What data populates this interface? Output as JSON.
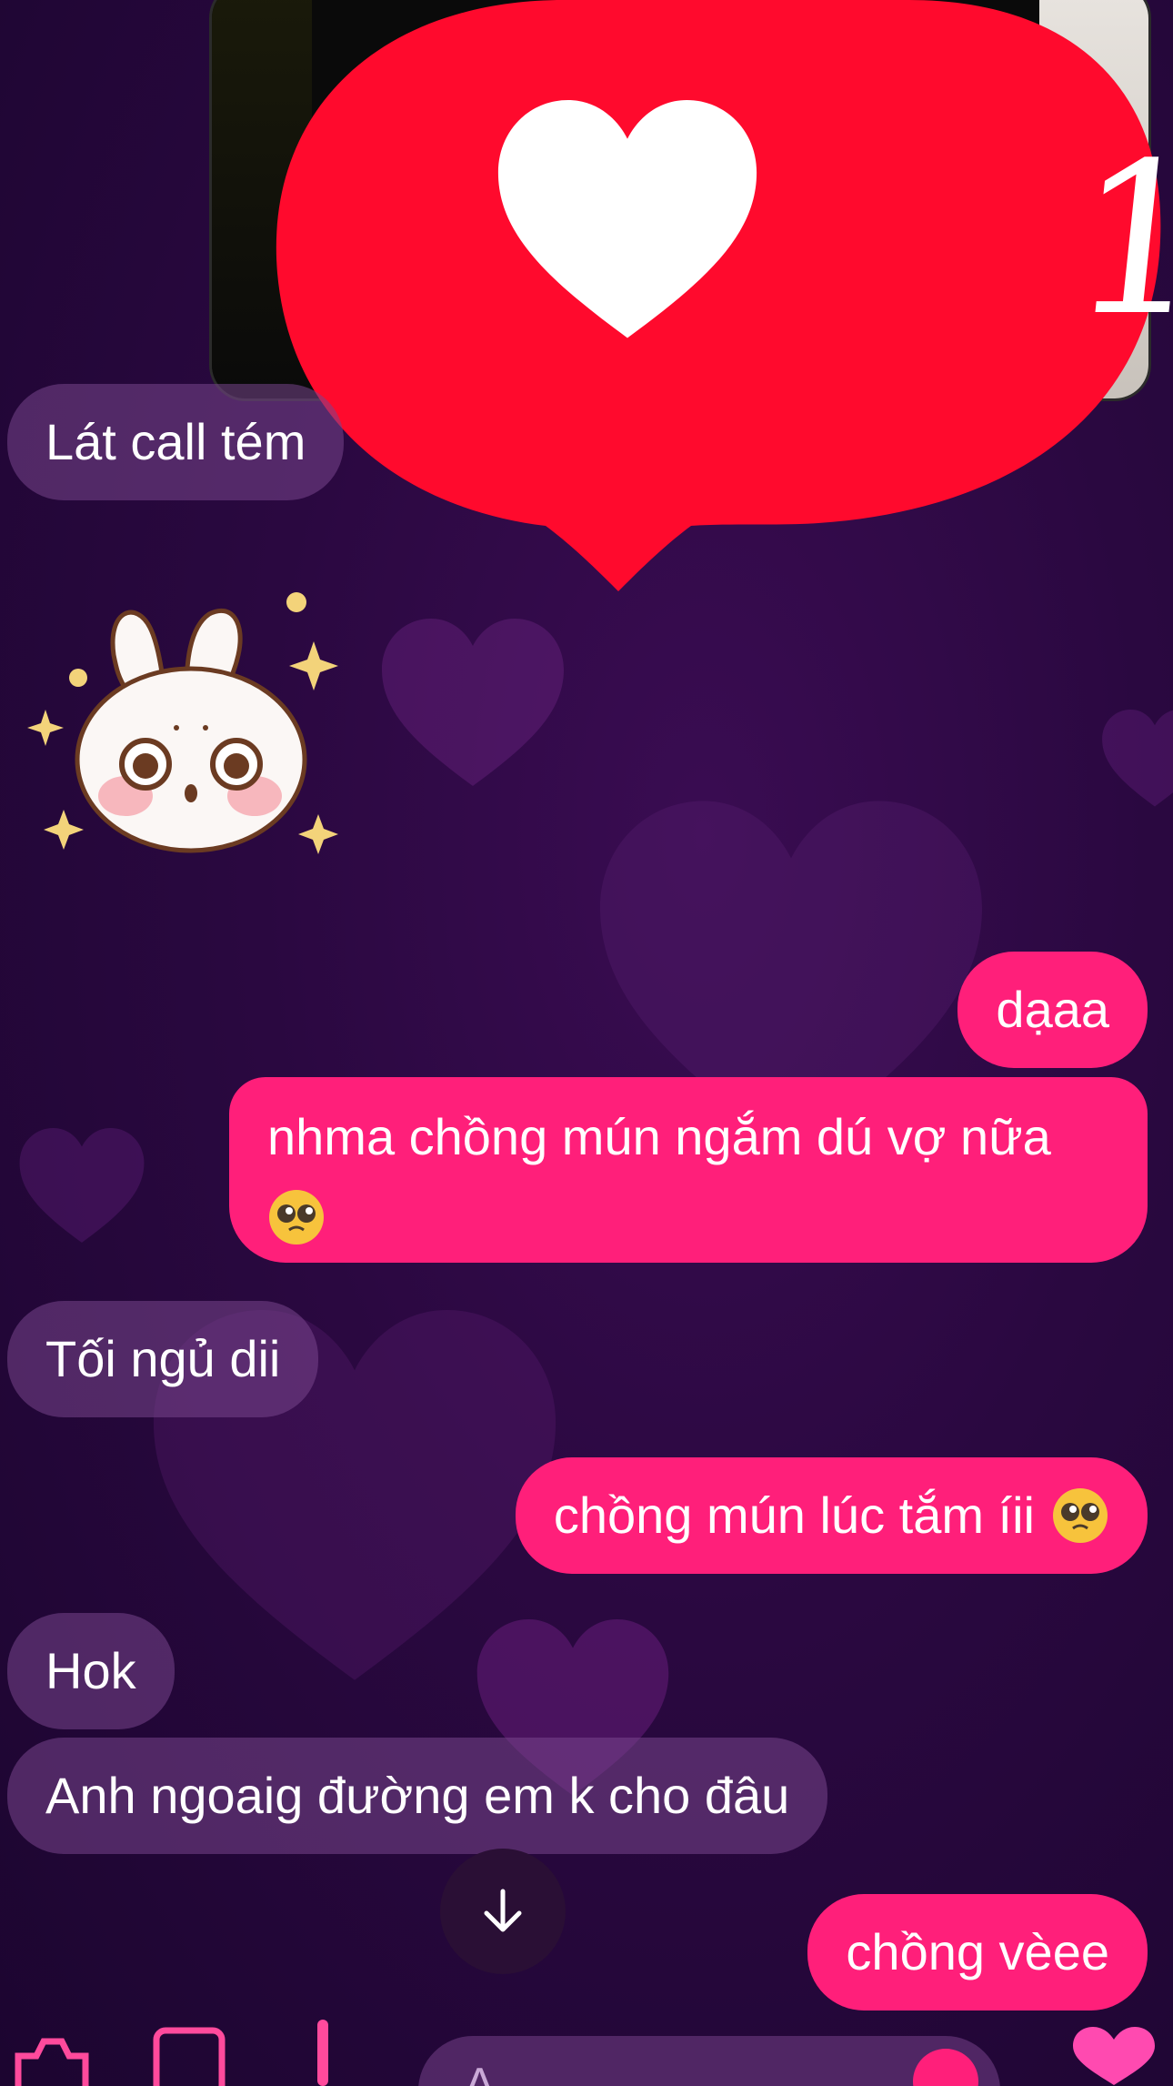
{
  "overlay": {
    "like_count": "1"
  },
  "messages": [
    {
      "sender": "them",
      "text": "Lát call tém"
    },
    {
      "sender": "them",
      "type": "sticker",
      "icon": "bunny-sticker"
    },
    {
      "sender": "me",
      "text": "dạaa"
    },
    {
      "sender": "me",
      "text_line1": "nhma chồng mún ngắm dú vợ nữa",
      "emoji": "pleading-face"
    },
    {
      "sender": "them",
      "text": "Tối ngủ dii"
    },
    {
      "sender": "me",
      "text": "chồng mún lúc tắm íii",
      "emoji": "pleading-face"
    },
    {
      "sender": "them",
      "text": "Hok"
    },
    {
      "sender": "them",
      "text": "Anh ngoaig đường em k cho đâu"
    },
    {
      "sender": "me",
      "text": "chồng vèee"
    }
  ],
  "composer": {
    "placeholder": "A...",
    "icons": [
      "camera-icon",
      "gallery-icon",
      "mic-icon",
      "sticker-icon",
      "heart-reaction-icon"
    ]
  },
  "colors": {
    "me_bubble": "#ff1f7a",
    "them_bubble": "#6e3f86",
    "like_red": "#ff0a2d",
    "background": "#2a0840"
  }
}
